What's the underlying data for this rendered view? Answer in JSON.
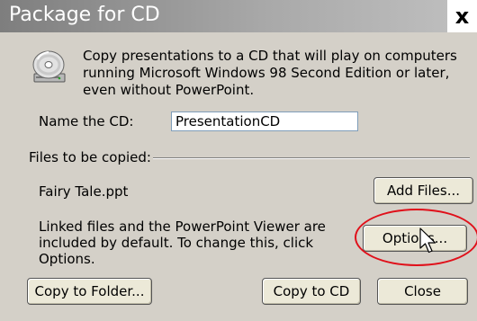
{
  "window": {
    "title": "Package for CD",
    "close_label": "x"
  },
  "description": "Copy presentations to a CD that will play on computers running Microsoft Windows 98 Second Edition or later, even without PowerPoint.",
  "name_cd": {
    "label": "Name the CD:",
    "value": "PresentationCD"
  },
  "files": {
    "section_label": "Files to be copied:",
    "file_name": "Fairy Tale.ppt",
    "add_files_label": "Add Files...",
    "linked_note": "Linked files and the PowerPoint Viewer are included by default. To change this, click Options.",
    "options_label": "Options..."
  },
  "footer": {
    "copy_to_folder_label": "Copy to Folder...",
    "copy_to_cd_label": "Copy to CD",
    "close_label": "Close"
  },
  "colors": {
    "highlight_ellipse": "#e0101a"
  },
  "icons": [
    "cd-drive-icon",
    "mouse-pointer-icon",
    "close-icon"
  ]
}
